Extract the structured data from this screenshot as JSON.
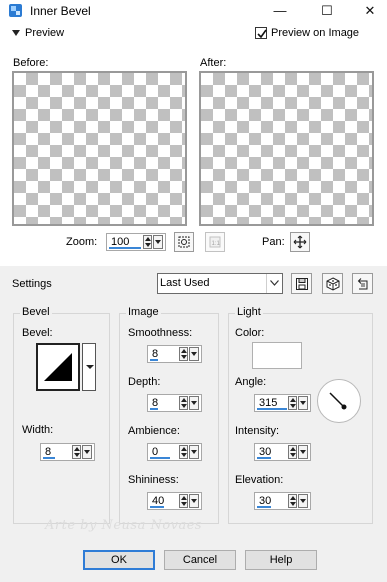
{
  "window": {
    "title": "Inner Bevel",
    "controls": {
      "minimize": "—",
      "maximize": "☐",
      "close": "✕"
    }
  },
  "preview": {
    "toggle_label": "Preview",
    "preview_on_image_label": "Preview on Image",
    "preview_on_image_checked": true,
    "before_label": "Before:",
    "after_label": "After:",
    "zoom_label": "Zoom:",
    "zoom_value": "100",
    "pan_label": "Pan:"
  },
  "settings": {
    "label": "Settings",
    "preset_value": "Last Used"
  },
  "bevel": {
    "group_title": "Bevel",
    "bevel_label": "Bevel:",
    "width_label": "Width:",
    "width_value": "8"
  },
  "image": {
    "group_title": "Image",
    "smoothness_label": "Smoothness:",
    "smoothness_value": "8",
    "depth_label": "Depth:",
    "depth_value": "8",
    "ambience_label": "Ambience:",
    "ambience_value": "0",
    "shininess_label": "Shininess:",
    "shininess_value": "40"
  },
  "light": {
    "group_title": "Light",
    "color_label": "Color:",
    "color_value": "#ffffff",
    "angle_label": "Angle:",
    "angle_value": "315",
    "intensity_label": "Intensity:",
    "intensity_value": "30",
    "elevation_label": "Elevation:",
    "elevation_value": "30"
  },
  "watermark": "Arte by Neusa Novaes",
  "buttons": {
    "ok": "OK",
    "cancel": "Cancel",
    "help": "Help"
  },
  "colors": {
    "accent": "#3a86d6",
    "panel_bg": "#f0f0f0",
    "checker": "#c0c0c0"
  },
  "icons": [
    "app-icon",
    "preview-triangle-icon",
    "checkbox-check-icon",
    "zoom-fit-icon",
    "zoom-1to1-icon",
    "pan-move-icon",
    "save-preset-icon",
    "randomize-icon",
    "reset-icon",
    "dropdown-arrow-icon"
  ]
}
